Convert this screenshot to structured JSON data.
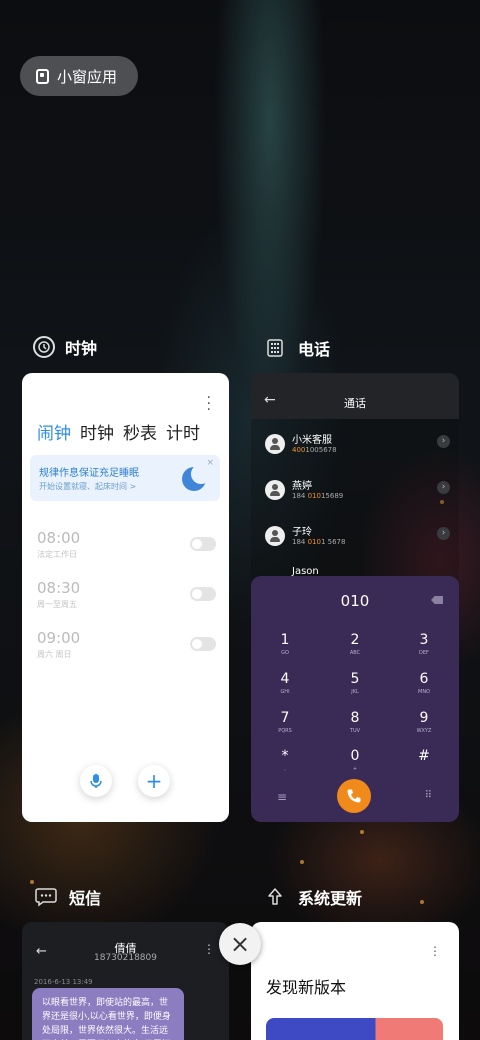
{
  "floating_button": {
    "label": "小窗应用",
    "icon": "small-window-icon"
  },
  "apps": {
    "clock": {
      "title": "时钟",
      "icon": "clock-icon",
      "tabs": [
        "闹钟",
        "时钟",
        "秒表",
        "计时"
      ],
      "active_tab": "闹钟",
      "banner": {
        "title": "规律作息保证充足睡眠",
        "subtitle": "开始设置就寝、起床时间 >",
        "close": "×"
      },
      "alarms": [
        {
          "time": "08:00",
          "label": "法定工作日",
          "enabled": false
        },
        {
          "time": "08:30",
          "label": "周一至周五",
          "enabled": false
        },
        {
          "time": "09:00",
          "label": "周六 周日",
          "enabled": false
        }
      ],
      "voice_icon": "mic-icon",
      "add_label": "+"
    },
    "phone": {
      "title": "电话",
      "icon": "phone-app-icon",
      "header": "通话",
      "back": "←",
      "contacts": [
        {
          "name": "小米客服",
          "number_prefix": "",
          "number_hl": "400",
          "number_rest": "1005678"
        },
        {
          "name": "燕婷",
          "number_prefix": "184 ",
          "number_hl": "010",
          "number_rest": "15689"
        },
        {
          "name": "子玲",
          "number_prefix": "184 ",
          "number_hl": "010",
          "number_rest": "1 5678"
        },
        {
          "name": "Jason",
          "number_prefix": "",
          "number_hl": "",
          "number_rest": ""
        }
      ],
      "dial_display": "010",
      "keys": [
        {
          "d": "1",
          "l": "GO"
        },
        {
          "d": "2",
          "l": "ABC"
        },
        {
          "d": "3",
          "l": "DEF"
        },
        {
          "d": "4",
          "l": "GHI"
        },
        {
          "d": "5",
          "l": "JKL"
        },
        {
          "d": "6",
          "l": "MNO"
        },
        {
          "d": "7",
          "l": "PQRS"
        },
        {
          "d": "8",
          "l": "TUV"
        },
        {
          "d": "9",
          "l": "WXYZ"
        },
        {
          "d": "*",
          "l": ","
        },
        {
          "d": "0",
          "l": "+"
        },
        {
          "d": "#",
          "l": ""
        }
      ],
      "call_icon": "call-icon",
      "dial_color": "#3a2a56",
      "call_color": "#f08a1a"
    },
    "sms": {
      "title": "短信",
      "icon": "message-icon",
      "contact_name": "倩倩",
      "contact_number": "18730218809",
      "date": "2016-6-13 13:49",
      "message": "以眼看世界，即使站的最高，世界还是很小,以心看世界，即便身处局限，世界依然很大。生活远不完美，需要用心去体会,无需拥有太多，要"
    },
    "update": {
      "title": "系统更新",
      "icon": "update-icon",
      "heading": "发现新版本"
    }
  },
  "close_all": "×",
  "accent": "#2e8de6"
}
